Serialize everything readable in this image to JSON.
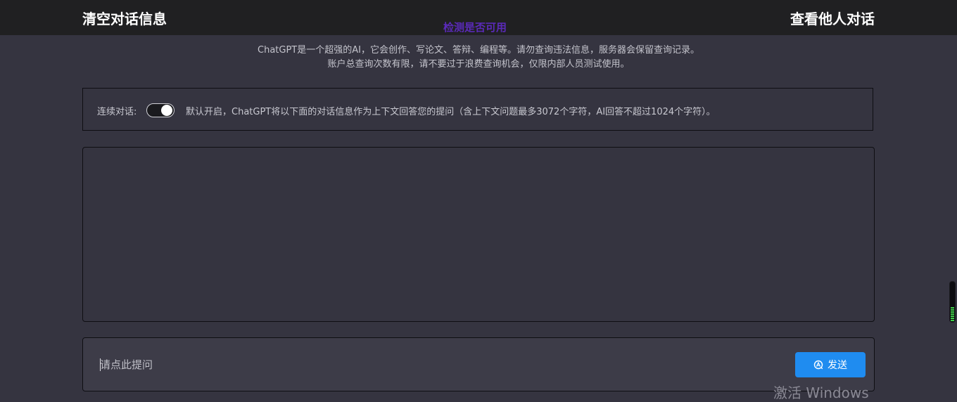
{
  "header": {
    "clear_label": "清空对话信息",
    "check_label": "检测是否可用",
    "view_others_label": "查看他人对话"
  },
  "notice": {
    "line1": "ChatGPT是一个超强的AI，它会创作、写论文、答辩、编程等。请勿查询违法信息，服务器会保留查询记录。",
    "line2": "账户总查询次数有限，请不要过于浪费查询机会，仅限内部人员测试使用。"
  },
  "settings": {
    "continuous_label": "连续对话:",
    "toggle_on": true,
    "description": "默认开启，ChatGPT将以下面的对话信息作为上下文回答您的提问（含上下文问题最多3072个字符，AI回答不超过1024个字符）。"
  },
  "input": {
    "placeholder": "请点此提问",
    "value": ""
  },
  "send_button": {
    "label": "发送",
    "icon": "send-icon"
  },
  "watermark": "激活 Windows",
  "side_meter": {
    "level": 0.35
  },
  "colors": {
    "background": "#353440",
    "topbar": "#202022",
    "check_link": "#5a2ab8",
    "send_button": "#1f8cf0"
  }
}
